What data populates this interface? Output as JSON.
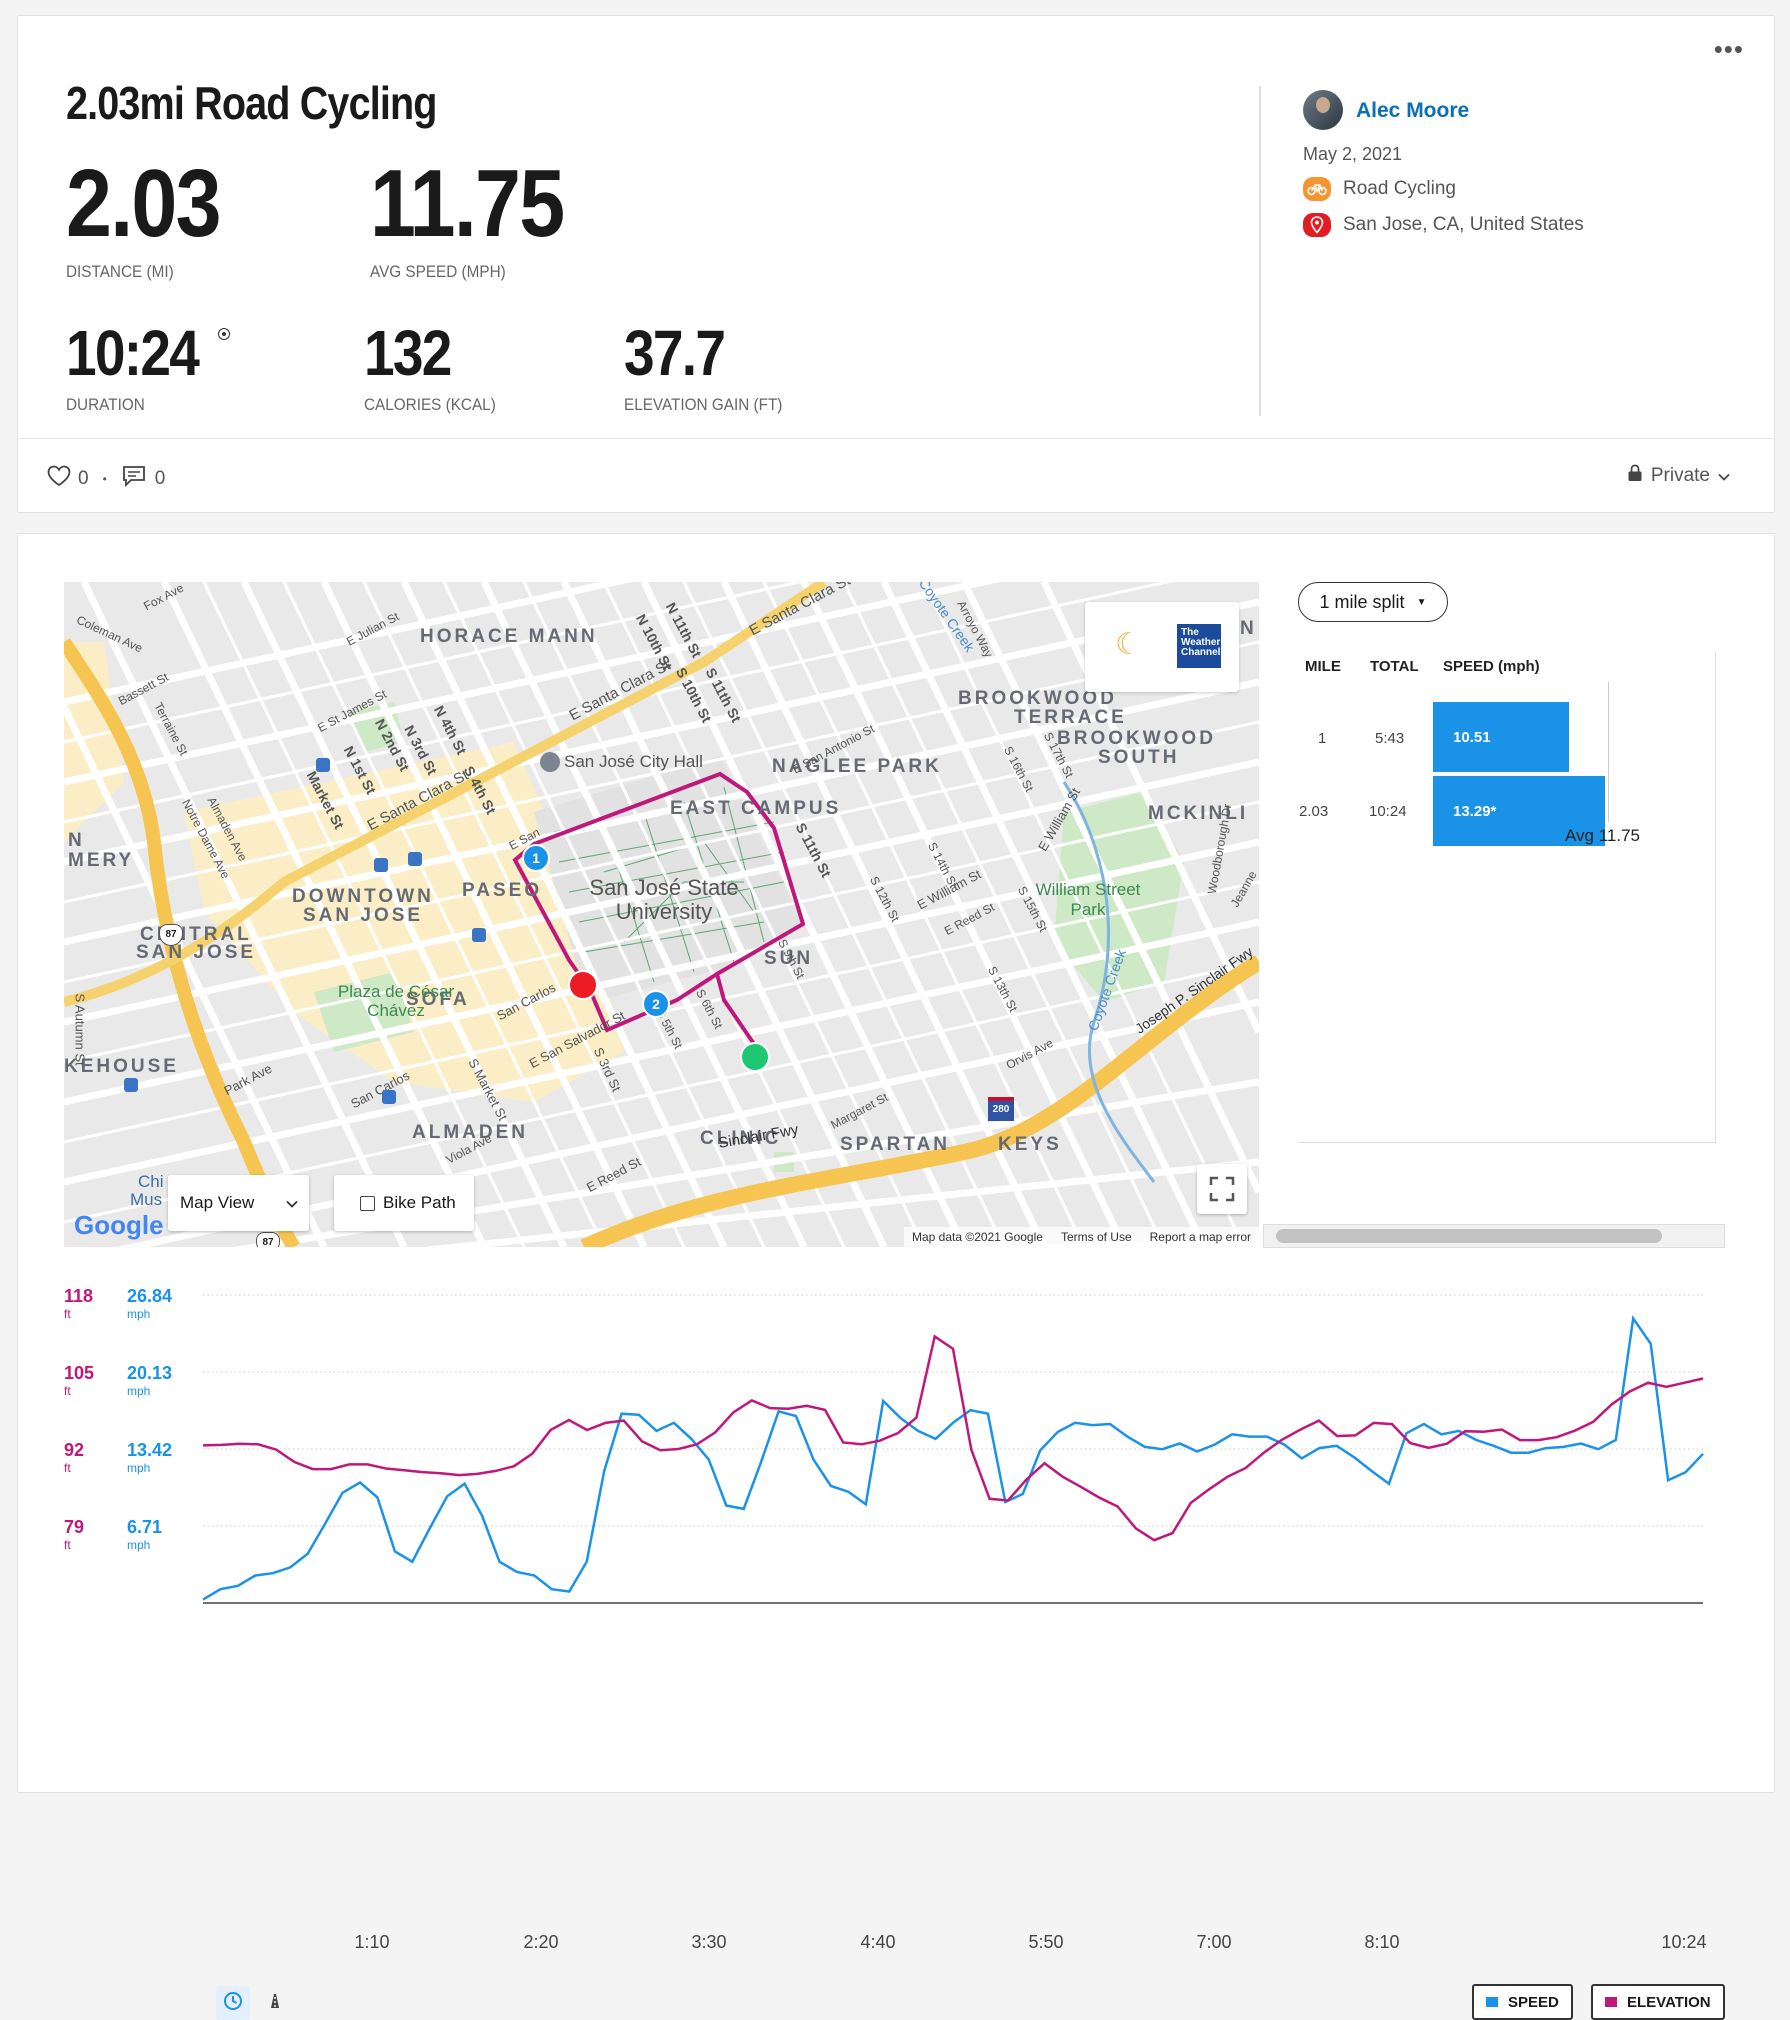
{
  "activity": {
    "title": "2.03mi Road Cycling",
    "menu": "•••",
    "distance": {
      "value": "2.03",
      "label": "DISTANCE (MI)"
    },
    "avg_speed": {
      "value": "11.75",
      "label": "AVG SPEED (MPH)"
    },
    "duration": {
      "value": "10:24",
      "label": "DURATION"
    },
    "calories": {
      "value": "132",
      "label": "CALORIES (KCAL)"
    },
    "elevation": {
      "value": "37.7",
      "label": "ELEVATION GAIN (FT)"
    }
  },
  "user": {
    "name": "Alec Moore",
    "date": "May 2, 2021",
    "activity_type": "Road Cycling",
    "location": "San Jose, CA, United States"
  },
  "social": {
    "likes": "0",
    "comments": "0",
    "privacy": "Private"
  },
  "map": {
    "areas": [
      "HORACE MANN",
      "BROOKWOOD",
      "TERRACE",
      "BROOKWOOD",
      "SOUTH",
      "NAGLEE PARK",
      "EAST CAMPUS",
      "MCKINLI",
      "N",
      "MERY",
      "DOWNTOWN",
      "SAN JOSE",
      "PASEO",
      "CENTRAL",
      "SAN JOSE",
      "SUN",
      "SOFA",
      "KEHOUSE",
      "CLINIC",
      "SPARTAN",
      "KEYS",
      "ALMADEN",
      "N"
    ],
    "university": "San José State University",
    "city_hall": "San José City Hall",
    "park": "William Street Park",
    "plaza": "Plaza de César Chávez",
    "streets": [
      "E Santa Clara St",
      "E Santa Clara St",
      "E Julian St",
      "E St James St",
      "Coleman Ave",
      "Coyote Creek",
      "Sinclair Fwy",
      "Joseph P. Sinclair Fwy",
      "E William St",
      "E William St",
      "San Carlos",
      "E San Salvador St",
      "S 3rd St",
      "S Market St",
      "Park Ave",
      "S Autumn St",
      "E Reed St",
      "N 10th St",
      "N 11th St",
      "S 10th St",
      "S 11th St",
      "S 11th St",
      "Market St",
      "N 1st St",
      "N 2nd St",
      "N 3rd St",
      "N 4th St",
      "S 4th St",
      "Fox Ave",
      "Bassett St",
      "Terraine St",
      "Almaden Ave",
      "Notre Dame Ave",
      "Woodborough Dr",
      "Orvis Ave",
      "Margaret St",
      "Viola Ave",
      "S 5th St",
      "S 6th St",
      "S 9th St",
      "S 12th St",
      "S 14th St",
      "S 15th St",
      "S 13th St",
      "E San Antonio St",
      "S 16th St",
      "S 17th St",
      "San Carlos",
      "E Reed St",
      "E San",
      "Jeanne",
      "Arroyo Way",
      "Chi",
      "Mus"
    ],
    "highway_shields": [
      "87",
      "280",
      "87"
    ],
    "weather_logo": "The Weather Channel",
    "moon": "☾",
    "map_view_label": "Map View",
    "bike_path_label": "Bike Path",
    "google": "Google",
    "attrib": [
      "Map data ©2021 Google",
      "Terms of Use",
      "Report a map error"
    ],
    "markers": [
      "1",
      "2"
    ]
  },
  "splits": {
    "selector": "1 mile split",
    "headers": [
      "MILE",
      "TOTAL",
      "SPEED (mph)"
    ],
    "rows": [
      {
        "mile": "1",
        "total": "5:43",
        "speed": "10.51",
        "speed_value": 10.51
      },
      {
        "mile": "2.03",
        "total": "10:24",
        "speed": "13.29*",
        "speed_value": 13.29
      }
    ],
    "avg_label": "Avg 11.75"
  },
  "chart_data": {
    "type": "line",
    "x_ticks": [
      "1:10",
      "2:20",
      "3:30",
      "4:40",
      "5:50",
      "7:00",
      "8:10",
      "10:24"
    ],
    "elevation_axis": {
      "values": [
        "118",
        "105",
        "92",
        "79"
      ],
      "unit": "ft",
      "ylim": [
        66,
        118
      ]
    },
    "speed_axis": {
      "values": [
        "26.84",
        "20.13",
        "13.42",
        "6.71"
      ],
      "unit": "mph",
      "ylim": [
        0,
        26.84
      ]
    },
    "series": [
      {
        "name": "SPEED",
        "color": "#1a92e8",
        "values": [
          0.3,
          1.2,
          1.5,
          2.4,
          2.6,
          3.1,
          4.3,
          6.9,
          9.6,
          10.5,
          9.2,
          4.5,
          3.6,
          6.5,
          9.3,
          10.4,
          7.6,
          3.6,
          2.7,
          2.4,
          1.2,
          1.0,
          3.6,
          11.5,
          16.5,
          16.4,
          15.0,
          15.7,
          14.3,
          12.5,
          8.5,
          8.2,
          12.3,
          16.7,
          16.3,
          12.5,
          10.2,
          9.7,
          8.6,
          17.6,
          16.1,
          15.0,
          14.3,
          15.7,
          16.8,
          16.5,
          8.8,
          9.5,
          13.3,
          14.9,
          15.7,
          15.5,
          15.6,
          14.5,
          13.6,
          13.4,
          13.9,
          13.2,
          13.8,
          14.7,
          14.5,
          14.5,
          13.8,
          12.6,
          13.5,
          13.7,
          12.7,
          11.5,
          10.4,
          14.8,
          15.6,
          14.7,
          15.0,
          14.2,
          13.7,
          13.1,
          13.1,
          13.5,
          13.6,
          13.9,
          13.4,
          14.2,
          24.8,
          22.6,
          10.7,
          11.4,
          13.0
        ]
      },
      {
        "name": "ELEVATION",
        "color": "#c0177a",
        "values": [
          92.6,
          92.7,
          92.9,
          92.8,
          91.9,
          89.8,
          88.6,
          88.6,
          89.4,
          89.4,
          88.7,
          88.4,
          88.1,
          87.9,
          87.6,
          87.8,
          88.3,
          89.1,
          91.2,
          95.2,
          96.9,
          95.2,
          96.4,
          96.8,
          93.3,
          91.8,
          92.0,
          92.8,
          94.8,
          98.2,
          100.2,
          98.9,
          98.8,
          99.3,
          98.6,
          93.1,
          92.8,
          93.4,
          94.7,
          97.3,
          111.0,
          108.9,
          91.9,
          83.6,
          83.3,
          86.8,
          89.6,
          87.3,
          85.6,
          83.8,
          82.3,
          78.6,
          76.6,
          77.8,
          82.9,
          85.2,
          87.3,
          88.8,
          91.4,
          93.6,
          95.3,
          96.8,
          94.2,
          94.3,
          96.4,
          96.2,
          93.0,
          92.2,
          92.9,
          95.0,
          94.9,
          95.3,
          93.5,
          93.5,
          94.0,
          95.1,
          96.6,
          99.5,
          101.7,
          103.2,
          102.5,
          103.2,
          103.9
        ]
      }
    ]
  },
  "legend": {
    "speed": "SPEED",
    "elevation": "ELEVATION"
  }
}
